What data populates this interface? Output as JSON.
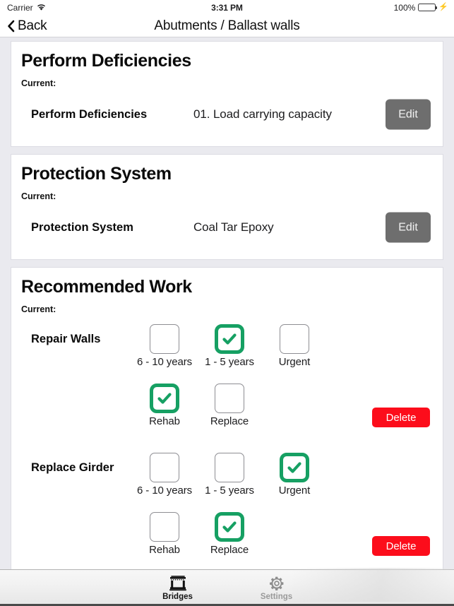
{
  "statusbar": {
    "carrier": "Carrier",
    "wifi_icon": "wifi-icon",
    "time": "3:31 PM",
    "battery_percent": "100%",
    "battery_icon": "battery-full-icon",
    "charging_icon": "lightning-bolt-icon"
  },
  "navbar": {
    "back_label": "Back",
    "back_icon": "chevron-left-icon",
    "title": "Abutments / Ballast walls"
  },
  "colors": {
    "page_background": "#EAEAEF",
    "card_background": "#FFFFFF",
    "checkbox_checked": "#16A063",
    "checkbox_unchecked_border": "#8E8E93",
    "edit_button": "#6E6E6E",
    "delete_button": "#FC0D1B",
    "battery_green": "#35C759",
    "tab_active": "#121212",
    "tab_inactive": "#9A9A9A"
  },
  "cards": [
    {
      "title": "Perform Deficiencies",
      "current_label": "Current:",
      "row": {
        "label": "Perform Deficiencies",
        "value": "01. Load carrying capacity",
        "edit_label": "Edit"
      }
    },
    {
      "title": "Protection System",
      "current_label": "Current:",
      "row": {
        "label": "Protection System",
        "value": "Coal Tar Epoxy",
        "edit_label": "Edit"
      }
    }
  ],
  "recommended_work": {
    "title": "Recommended Work",
    "current_label": "Current:",
    "delete_label": "Delete",
    "items": [
      {
        "name": "Repair Walls",
        "timeframe_options": [
          {
            "label": "6 - 10 years",
            "checked": false
          },
          {
            "label": "1 - 5 years",
            "checked": true
          },
          {
            "label": "Urgent",
            "checked": false
          }
        ],
        "action_options": [
          {
            "label": "Rehab",
            "checked": true
          },
          {
            "label": "Replace",
            "checked": false
          }
        ]
      },
      {
        "name": "Replace Girder",
        "timeframe_options": [
          {
            "label": "6 - 10 years",
            "checked": false
          },
          {
            "label": "1 - 5 years",
            "checked": false
          },
          {
            "label": "Urgent",
            "checked": true
          }
        ],
        "action_options": [
          {
            "label": "Rehab",
            "checked": false
          },
          {
            "label": "Replace",
            "checked": true
          }
        ]
      }
    ]
  },
  "tabbar": {
    "tabs": [
      {
        "label": "Bridges",
        "icon": "bridge-icon",
        "active": true
      },
      {
        "label": "Settings",
        "icon": "gear-icon",
        "active": false
      }
    ]
  }
}
